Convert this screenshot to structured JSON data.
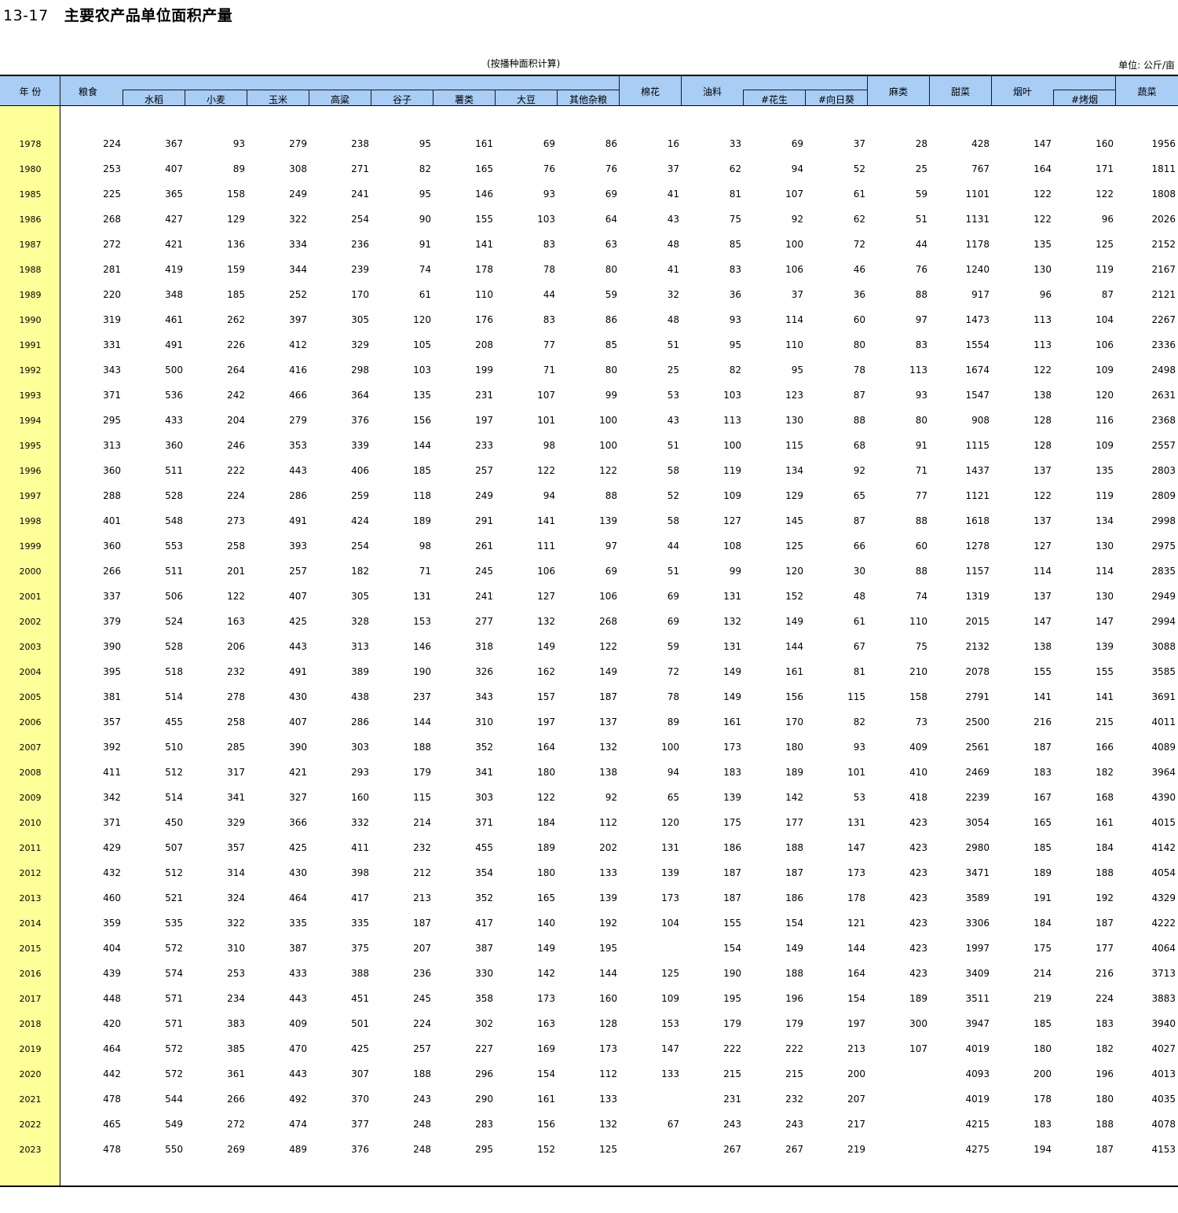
{
  "title": {
    "number": "13-17",
    "text": "主要农产品单位面积产量"
  },
  "subtitle": "(按播种面积计算)",
  "unit": "单位: 公斤/亩",
  "header": {
    "year": "年  份",
    "grain": "粮食",
    "rice": "水稻",
    "wheat": "小麦",
    "corn": "玉米",
    "sorghum": "高粱",
    "millet": "谷子",
    "tubers": "薯类",
    "soybean": "大豆",
    "other_grain": "其他杂粮",
    "cotton": "棉花",
    "oil": "油料",
    "peanut": "#花生",
    "sunflower": "#向日葵",
    "hemp": "麻类",
    "beet": "甜菜",
    "tobacco": "烟叶",
    "flue_cured": "#烤烟",
    "vegetables": "蔬菜"
  },
  "rows": [
    [
      "1978",
      "224",
      "367",
      "93",
      "279",
      "238",
      "95",
      "161",
      "69",
      "86",
      "16",
      "33",
      "69",
      "37",
      "28",
      "428",
      "147",
      "160",
      "1956"
    ],
    [
      "1980",
      "253",
      "407",
      "89",
      "308",
      "271",
      "82",
      "165",
      "76",
      "76",
      "37",
      "62",
      "94",
      "52",
      "25",
      "767",
      "164",
      "171",
      "1811"
    ],
    [
      "1985",
      "225",
      "365",
      "158",
      "249",
      "241",
      "95",
      "146",
      "93",
      "69",
      "41",
      "81",
      "107",
      "61",
      "59",
      "1101",
      "122",
      "122",
      "1808"
    ],
    [
      "1986",
      "268",
      "427",
      "129",
      "322",
      "254",
      "90",
      "155",
      "103",
      "64",
      "43",
      "75",
      "92",
      "62",
      "51",
      "1131",
      "122",
      "96",
      "2026"
    ],
    [
      "1987",
      "272",
      "421",
      "136",
      "334",
      "236",
      "91",
      "141",
      "83",
      "63",
      "48",
      "85",
      "100",
      "72",
      "44",
      "1178",
      "135",
      "125",
      "2152"
    ],
    [
      "1988",
      "281",
      "419",
      "159",
      "344",
      "239",
      "74",
      "178",
      "78",
      "80",
      "41",
      "83",
      "106",
      "46",
      "76",
      "1240",
      "130",
      "119",
      "2167"
    ],
    [
      "1989",
      "220",
      "348",
      "185",
      "252",
      "170",
      "61",
      "110",
      "44",
      "59",
      "32",
      "36",
      "37",
      "36",
      "88",
      "917",
      "96",
      "87",
      "2121"
    ],
    [
      "1990",
      "319",
      "461",
      "262",
      "397",
      "305",
      "120",
      "176",
      "83",
      "86",
      "48",
      "93",
      "114",
      "60",
      "97",
      "1473",
      "113",
      "104",
      "2267"
    ],
    [
      "1991",
      "331",
      "491",
      "226",
      "412",
      "329",
      "105",
      "208",
      "77",
      "85",
      "51",
      "95",
      "110",
      "80",
      "83",
      "1554",
      "113",
      "106",
      "2336"
    ],
    [
      "1992",
      "343",
      "500",
      "264",
      "416",
      "298",
      "103",
      "199",
      "71",
      "80",
      "25",
      "82",
      "95",
      "78",
      "113",
      "1674",
      "122",
      "109",
      "2498"
    ],
    [
      "1993",
      "371",
      "536",
      "242",
      "466",
      "364",
      "135",
      "231",
      "107",
      "99",
      "53",
      "103",
      "123",
      "87",
      "93",
      "1547",
      "138",
      "120",
      "2631"
    ],
    [
      "1994",
      "295",
      "433",
      "204",
      "279",
      "376",
      "156",
      "197",
      "101",
      "100",
      "43",
      "113",
      "130",
      "88",
      "80",
      "908",
      "128",
      "116",
      "2368"
    ],
    [
      "1995",
      "313",
      "360",
      "246",
      "353",
      "339",
      "144",
      "233",
      "98",
      "100",
      "51",
      "100",
      "115",
      "68",
      "91",
      "1115",
      "128",
      "109",
      "2557"
    ],
    [
      "1996",
      "360",
      "511",
      "222",
      "443",
      "406",
      "185",
      "257",
      "122",
      "122",
      "58",
      "119",
      "134",
      "92",
      "71",
      "1437",
      "137",
      "135",
      "2803"
    ],
    [
      "1997",
      "288",
      "528",
      "224",
      "286",
      "259",
      "118",
      "249",
      "94",
      "88",
      "52",
      "109",
      "129",
      "65",
      "77",
      "1121",
      "122",
      "119",
      "2809"
    ],
    [
      "1998",
      "401",
      "548",
      "273",
      "491",
      "424",
      "189",
      "291",
      "141",
      "139",
      "58",
      "127",
      "145",
      "87",
      "88",
      "1618",
      "137",
      "134",
      "2998"
    ],
    [
      "1999",
      "360",
      "553",
      "258",
      "393",
      "254",
      "98",
      "261",
      "111",
      "97",
      "44",
      "108",
      "125",
      "66",
      "60",
      "1278",
      "127",
      "130",
      "2975"
    ],
    [
      "2000",
      "266",
      "511",
      "201",
      "257",
      "182",
      "71",
      "245",
      "106",
      "69",
      "51",
      "99",
      "120",
      "30",
      "88",
      "1157",
      "114",
      "114",
      "2835"
    ],
    [
      "2001",
      "337",
      "506",
      "122",
      "407",
      "305",
      "131",
      "241",
      "127",
      "106",
      "69",
      "131",
      "152",
      "48",
      "74",
      "1319",
      "137",
      "130",
      "2949"
    ],
    [
      "2002",
      "379",
      "524",
      "163",
      "425",
      "328",
      "153",
      "277",
      "132",
      "268",
      "69",
      "132",
      "149",
      "61",
      "110",
      "2015",
      "147",
      "147",
      "2994"
    ],
    [
      "2003",
      "390",
      "528",
      "206",
      "443",
      "313",
      "146",
      "318",
      "149",
      "122",
      "59",
      "131",
      "144",
      "67",
      "75",
      "2132",
      "138",
      "139",
      "3088"
    ],
    [
      "2004",
      "395",
      "518",
      "232",
      "491",
      "389",
      "190",
      "326",
      "162",
      "149",
      "72",
      "149",
      "161",
      "81",
      "210",
      "2078",
      "155",
      "155",
      "3585"
    ],
    [
      "2005",
      "381",
      "514",
      "278",
      "430",
      "438",
      "237",
      "343",
      "157",
      "187",
      "78",
      "149",
      "156",
      "115",
      "158",
      "2791",
      "141",
      "141",
      "3691"
    ],
    [
      "2006",
      "357",
      "455",
      "258",
      "407",
      "286",
      "144",
      "310",
      "197",
      "137",
      "89",
      "161",
      "170",
      "82",
      "73",
      "2500",
      "216",
      "215",
      "4011"
    ],
    [
      "2007",
      "392",
      "510",
      "285",
      "390",
      "303",
      "188",
      "352",
      "164",
      "132",
      "100",
      "173",
      "180",
      "93",
      "409",
      "2561",
      "187",
      "166",
      "4089"
    ],
    [
      "2008",
      "411",
      "512",
      "317",
      "421",
      "293",
      "179",
      "341",
      "180",
      "138",
      "94",
      "183",
      "189",
      "101",
      "410",
      "2469",
      "183",
      "182",
      "3964"
    ],
    [
      "2009",
      "342",
      "514",
      "341",
      "327",
      "160",
      "115",
      "303",
      "122",
      "92",
      "65",
      "139",
      "142",
      "53",
      "418",
      "2239",
      "167",
      "168",
      "4390"
    ],
    [
      "2010",
      "371",
      "450",
      "329",
      "366",
      "332",
      "214",
      "371",
      "184",
      "112",
      "120",
      "175",
      "177",
      "131",
      "423",
      "3054",
      "165",
      "161",
      "4015"
    ],
    [
      "2011",
      "429",
      "507",
      "357",
      "425",
      "411",
      "232",
      "455",
      "189",
      "202",
      "131",
      "186",
      "188",
      "147",
      "423",
      "2980",
      "185",
      "184",
      "4142"
    ],
    [
      "2012",
      "432",
      "512",
      "314",
      "430",
      "398",
      "212",
      "354",
      "180",
      "133",
      "139",
      "187",
      "187",
      "173",
      "423",
      "3471",
      "189",
      "188",
      "4054"
    ],
    [
      "2013",
      "460",
      "521",
      "324",
      "464",
      "417",
      "213",
      "352",
      "165",
      "139",
      "173",
      "187",
      "186",
      "178",
      "423",
      "3589",
      "191",
      "192",
      "4329"
    ],
    [
      "2014",
      "359",
      "535",
      "322",
      "335",
      "335",
      "187",
      "417",
      "140",
      "192",
      "104",
      "155",
      "154",
      "121",
      "423",
      "3306",
      "184",
      "187",
      "4222"
    ],
    [
      "2015",
      "404",
      "572",
      "310",
      "387",
      "375",
      "207",
      "387",
      "149",
      "195",
      "",
      "154",
      "149",
      "144",
      "423",
      "1997",
      "175",
      "177",
      "4064"
    ],
    [
      "2016",
      "439",
      "574",
      "253",
      "433",
      "388",
      "236",
      "330",
      "142",
      "144",
      "125",
      "190",
      "188",
      "164",
      "423",
      "3409",
      "214",
      "216",
      "3713"
    ],
    [
      "2017",
      "448",
      "571",
      "234",
      "443",
      "451",
      "245",
      "358",
      "173",
      "160",
      "109",
      "195",
      "196",
      "154",
      "189",
      "3511",
      "219",
      "224",
      "3883"
    ],
    [
      "2018",
      "420",
      "571",
      "383",
      "409",
      "501",
      "224",
      "302",
      "163",
      "128",
      "153",
      "179",
      "179",
      "197",
      "300",
      "3947",
      "185",
      "183",
      "3940"
    ],
    [
      "2019",
      "464",
      "572",
      "385",
      "470",
      "425",
      "257",
      "227",
      "169",
      "173",
      "147",
      "222",
      "222",
      "213",
      "107",
      "4019",
      "180",
      "182",
      "4027"
    ],
    [
      "2020",
      "442",
      "572",
      "361",
      "443",
      "307",
      "188",
      "296",
      "154",
      "112",
      "133",
      "215",
      "215",
      "200",
      "",
      "4093",
      "200",
      "196",
      "4013"
    ],
    [
      "2021",
      "478",
      "544",
      "266",
      "492",
      "370",
      "243",
      "290",
      "161",
      "133",
      "",
      "231",
      "232",
      "207",
      "",
      "4019",
      "178",
      "180",
      "4035"
    ],
    [
      "2022",
      "465",
      "549",
      "272",
      "474",
      "377",
      "248",
      "283",
      "156",
      "132",
      "67",
      "243",
      "243",
      "217",
      "",
      "4215",
      "183",
      "188",
      "4078"
    ],
    [
      "2023",
      "478",
      "550",
      "269",
      "489",
      "376",
      "248",
      "295",
      "152",
      "125",
      "",
      "267",
      "267",
      "219",
      "",
      "4275",
      "194",
      "187",
      "4153"
    ]
  ]
}
